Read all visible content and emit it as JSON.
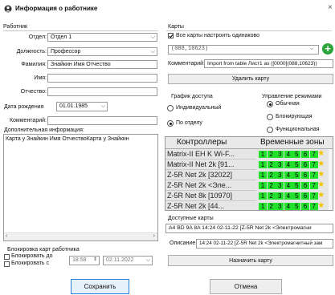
{
  "window": {
    "title": "Информация о работнике",
    "close": "×"
  },
  "worker": {
    "section": "Работник",
    "dept_label": "Отдел:",
    "dept_value": "Отдел 1",
    "position_label": "Должность:",
    "position_value": "Профессор",
    "surname_label": "Фамилия:",
    "surname_value": "Знайкин Имя Отчество",
    "name_label": "Имя:",
    "name_value": "",
    "patronymic_label": "Отчество:",
    "patronymic_value": "",
    "birth_label": "Дата рождения",
    "birth_value": "01.01.1985",
    "comment_label": "Комментарий:",
    "comment_value": "",
    "extra_label": "Дополнительная информация:",
    "extra_value": "Карта у Знайкин Имя ОтчествоКарта у Знайкин"
  },
  "block": {
    "section": "Блокировка карт работника",
    "until_label": "Блокировать до",
    "from_label": "Блокировать с",
    "time_value": "18:58",
    "date_value": "02.11.2022"
  },
  "cards": {
    "section": "Карты",
    "same_label": "Все карты настроить одинаково",
    "card_value": "(088,10623)",
    "comment_label": "Комментарий:",
    "comment_value": "Import from table Лист1 as ([0000](088,10623))",
    "delete_label": "Удалить карту",
    "add_icon": "+"
  },
  "schedule": {
    "title": "График доступа",
    "individual": "Индивидуальный",
    "by_dept": "По отделу"
  },
  "mode": {
    "title": "Управление режимами",
    "normal": "Обычная",
    "blocking": "Блокирующая",
    "functional": "Функциональная"
  },
  "controllers": {
    "col_controllers": "Контроллеры",
    "col_zones": "Временные зоны",
    "zones": [
      "1",
      "2",
      "3",
      "4",
      "5",
      "6",
      "7"
    ],
    "rows": [
      {
        "name": "Matrix-II EH K Wi-F..."
      },
      {
        "name": "Matrix-II Net 2k [91..."
      },
      {
        "name": "Z-5R Net 2k [32022]"
      },
      {
        "name": "Z-5R Net 2k <Эле..."
      },
      {
        "name": "Z-5R Net 8k [10970]"
      },
      {
        "name": "Z-5R Net 2k [44..."
      }
    ]
  },
  "available": {
    "title": "Доступные карты",
    "value": "A4 BD 9A 8A 14:24 02-11-22 [Z-5R Net 2k <Электромагни",
    "desc_label": "Описание:",
    "desc_value": "14:24 02-11-22 [Z-5R Net 2k <Электромагнитный зам",
    "assign_label": "Назначить карту"
  },
  "footer": {
    "save": "Сохранить",
    "cancel": "Отмена"
  },
  "colors": {
    "zone_green": "#22e02c",
    "star": "#f3c300",
    "add_green": "#2ea43c"
  }
}
